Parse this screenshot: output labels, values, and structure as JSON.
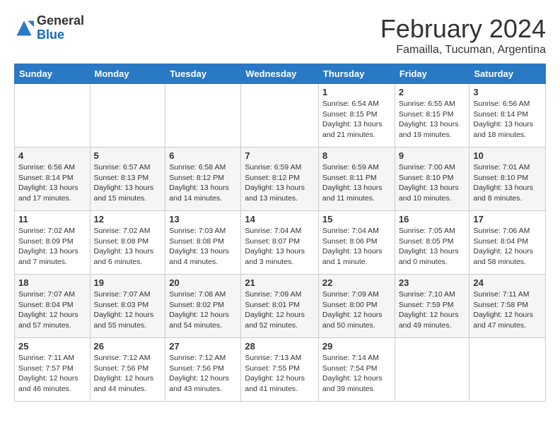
{
  "header": {
    "logo_general": "General",
    "logo_blue": "Blue",
    "title": "February 2024",
    "subtitle": "Famailla, Tucuman, Argentina"
  },
  "weekdays": [
    "Sunday",
    "Monday",
    "Tuesday",
    "Wednesday",
    "Thursday",
    "Friday",
    "Saturday"
  ],
  "weeks": [
    [
      {
        "day": "",
        "info": ""
      },
      {
        "day": "",
        "info": ""
      },
      {
        "day": "",
        "info": ""
      },
      {
        "day": "",
        "info": ""
      },
      {
        "day": "1",
        "info": "Sunrise: 6:54 AM\nSunset: 8:15 PM\nDaylight: 13 hours\nand 21 minutes."
      },
      {
        "day": "2",
        "info": "Sunrise: 6:55 AM\nSunset: 8:15 PM\nDaylight: 13 hours\nand 19 minutes."
      },
      {
        "day": "3",
        "info": "Sunrise: 6:56 AM\nSunset: 8:14 PM\nDaylight: 13 hours\nand 18 minutes."
      }
    ],
    [
      {
        "day": "4",
        "info": "Sunrise: 6:56 AM\nSunset: 8:14 PM\nDaylight: 13 hours\nand 17 minutes."
      },
      {
        "day": "5",
        "info": "Sunrise: 6:57 AM\nSunset: 8:13 PM\nDaylight: 13 hours\nand 15 minutes."
      },
      {
        "day": "6",
        "info": "Sunrise: 6:58 AM\nSunset: 8:12 PM\nDaylight: 13 hours\nand 14 minutes."
      },
      {
        "day": "7",
        "info": "Sunrise: 6:59 AM\nSunset: 8:12 PM\nDaylight: 13 hours\nand 13 minutes."
      },
      {
        "day": "8",
        "info": "Sunrise: 6:59 AM\nSunset: 8:11 PM\nDaylight: 13 hours\nand 11 minutes."
      },
      {
        "day": "9",
        "info": "Sunrise: 7:00 AM\nSunset: 8:10 PM\nDaylight: 13 hours\nand 10 minutes."
      },
      {
        "day": "10",
        "info": "Sunrise: 7:01 AM\nSunset: 8:10 PM\nDaylight: 13 hours\nand 8 minutes."
      }
    ],
    [
      {
        "day": "11",
        "info": "Sunrise: 7:02 AM\nSunset: 8:09 PM\nDaylight: 13 hours\nand 7 minutes."
      },
      {
        "day": "12",
        "info": "Sunrise: 7:02 AM\nSunset: 8:08 PM\nDaylight: 13 hours\nand 6 minutes."
      },
      {
        "day": "13",
        "info": "Sunrise: 7:03 AM\nSunset: 8:08 PM\nDaylight: 13 hours\nand 4 minutes."
      },
      {
        "day": "14",
        "info": "Sunrise: 7:04 AM\nSunset: 8:07 PM\nDaylight: 13 hours\nand 3 minutes."
      },
      {
        "day": "15",
        "info": "Sunrise: 7:04 AM\nSunset: 8:06 PM\nDaylight: 13 hours\nand 1 minute."
      },
      {
        "day": "16",
        "info": "Sunrise: 7:05 AM\nSunset: 8:05 PM\nDaylight: 13 hours\nand 0 minutes."
      },
      {
        "day": "17",
        "info": "Sunrise: 7:06 AM\nSunset: 8:04 PM\nDaylight: 12 hours\nand 58 minutes."
      }
    ],
    [
      {
        "day": "18",
        "info": "Sunrise: 7:07 AM\nSunset: 8:04 PM\nDaylight: 12 hours\nand 57 minutes."
      },
      {
        "day": "19",
        "info": "Sunrise: 7:07 AM\nSunset: 8:03 PM\nDaylight: 12 hours\nand 55 minutes."
      },
      {
        "day": "20",
        "info": "Sunrise: 7:08 AM\nSunset: 8:02 PM\nDaylight: 12 hours\nand 54 minutes."
      },
      {
        "day": "21",
        "info": "Sunrise: 7:09 AM\nSunset: 8:01 PM\nDaylight: 12 hours\nand 52 minutes."
      },
      {
        "day": "22",
        "info": "Sunrise: 7:09 AM\nSunset: 8:00 PM\nDaylight: 12 hours\nand 50 minutes."
      },
      {
        "day": "23",
        "info": "Sunrise: 7:10 AM\nSunset: 7:59 PM\nDaylight: 12 hours\nand 49 minutes."
      },
      {
        "day": "24",
        "info": "Sunrise: 7:11 AM\nSunset: 7:58 PM\nDaylight: 12 hours\nand 47 minutes."
      }
    ],
    [
      {
        "day": "25",
        "info": "Sunrise: 7:11 AM\nSunset: 7:57 PM\nDaylight: 12 hours\nand 46 minutes."
      },
      {
        "day": "26",
        "info": "Sunrise: 7:12 AM\nSunset: 7:56 PM\nDaylight: 12 hours\nand 44 minutes."
      },
      {
        "day": "27",
        "info": "Sunrise: 7:12 AM\nSunset: 7:56 PM\nDaylight: 12 hours\nand 43 minutes."
      },
      {
        "day": "28",
        "info": "Sunrise: 7:13 AM\nSunset: 7:55 PM\nDaylight: 12 hours\nand 41 minutes."
      },
      {
        "day": "29",
        "info": "Sunrise: 7:14 AM\nSunset: 7:54 PM\nDaylight: 12 hours\nand 39 minutes."
      },
      {
        "day": "",
        "info": ""
      },
      {
        "day": "",
        "info": ""
      }
    ]
  ]
}
